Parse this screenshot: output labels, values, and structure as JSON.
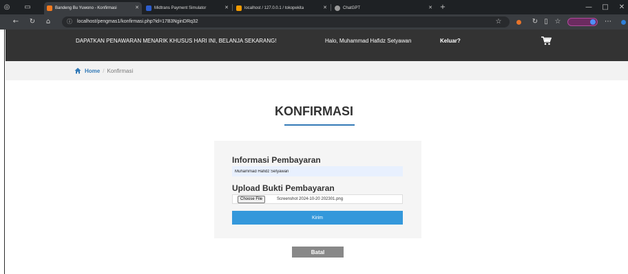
{
  "browser": {
    "tabs": [
      {
        "title": "Bandeng Bu Yuwono - Konfirmasi",
        "active": true,
        "favicon_color": "#f47a1f"
      },
      {
        "title": "Midtrans Payment Simulator",
        "active": false,
        "favicon_color": "#2c5dcd"
      },
      {
        "title": "localhost / 127.0.0.1 / tokopekita",
        "active": false,
        "favicon_color": "#f29a00"
      },
      {
        "title": "ChatGPT",
        "active": false,
        "favicon_color": "#9a9a9a"
      }
    ],
    "address": "localhost/pengmas1/konfirmasi.php?id=17B3NginDRq32",
    "icons": {
      "back": "back-arrow-icon",
      "reload": "reload-icon",
      "home": "home-icon",
      "info": "info-icon",
      "star": "star-icon",
      "new_tab": "plus-icon",
      "menu": "more-icon"
    }
  },
  "header": {
    "promo": "DAPATKAN PENAWARAN MENARIK KHUSUS HARI INI, BELANJA SEKARANG!",
    "greeting": "Halo, Muhammad Hafidz Setyawan",
    "logout": "Keluar?",
    "cart_icon": "cart-icon"
  },
  "breadcrumb": {
    "home_icon": "home-icon",
    "home": "Home",
    "separator": "/",
    "current": "Konfirmasi"
  },
  "page": {
    "title": "KONFIRMASI"
  },
  "form": {
    "payment_info_label": "Informasi Pembayaran",
    "customer_name": "Muhammad Hafidz Setyawan",
    "upload_label": "Upload Bukti Pembayaran",
    "choose_file_label": "Choose File",
    "file_name": "Screenshot 2024-10-20 202301.png",
    "submit_label": "Kirim",
    "cancel_label": "Batal"
  },
  "colors": {
    "header_bg": "#333333",
    "accent": "#337ab7",
    "submit_bg": "#3498db",
    "cancel_bg": "#888888",
    "panel_bg": "#f5f5f5"
  }
}
